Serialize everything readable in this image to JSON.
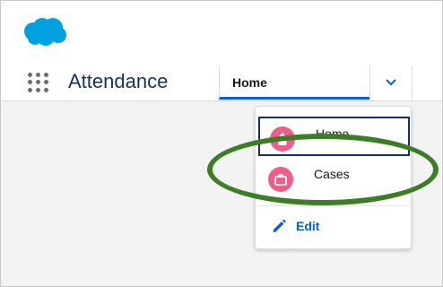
{
  "nav": {
    "app_name": "Attendance",
    "active_tab": "Home"
  },
  "menu": {
    "items": [
      {
        "label": "Home",
        "icon": "home-icon",
        "selected": true
      },
      {
        "label": "Cases",
        "icon": "briefcase-icon",
        "selected": false
      }
    ],
    "edit_label": "Edit"
  },
  "colors": {
    "brand": "#00a1e0",
    "accent": "#0a5fd6",
    "icon_pink": "#ee5e8a",
    "annotation": "#3d7d27"
  }
}
